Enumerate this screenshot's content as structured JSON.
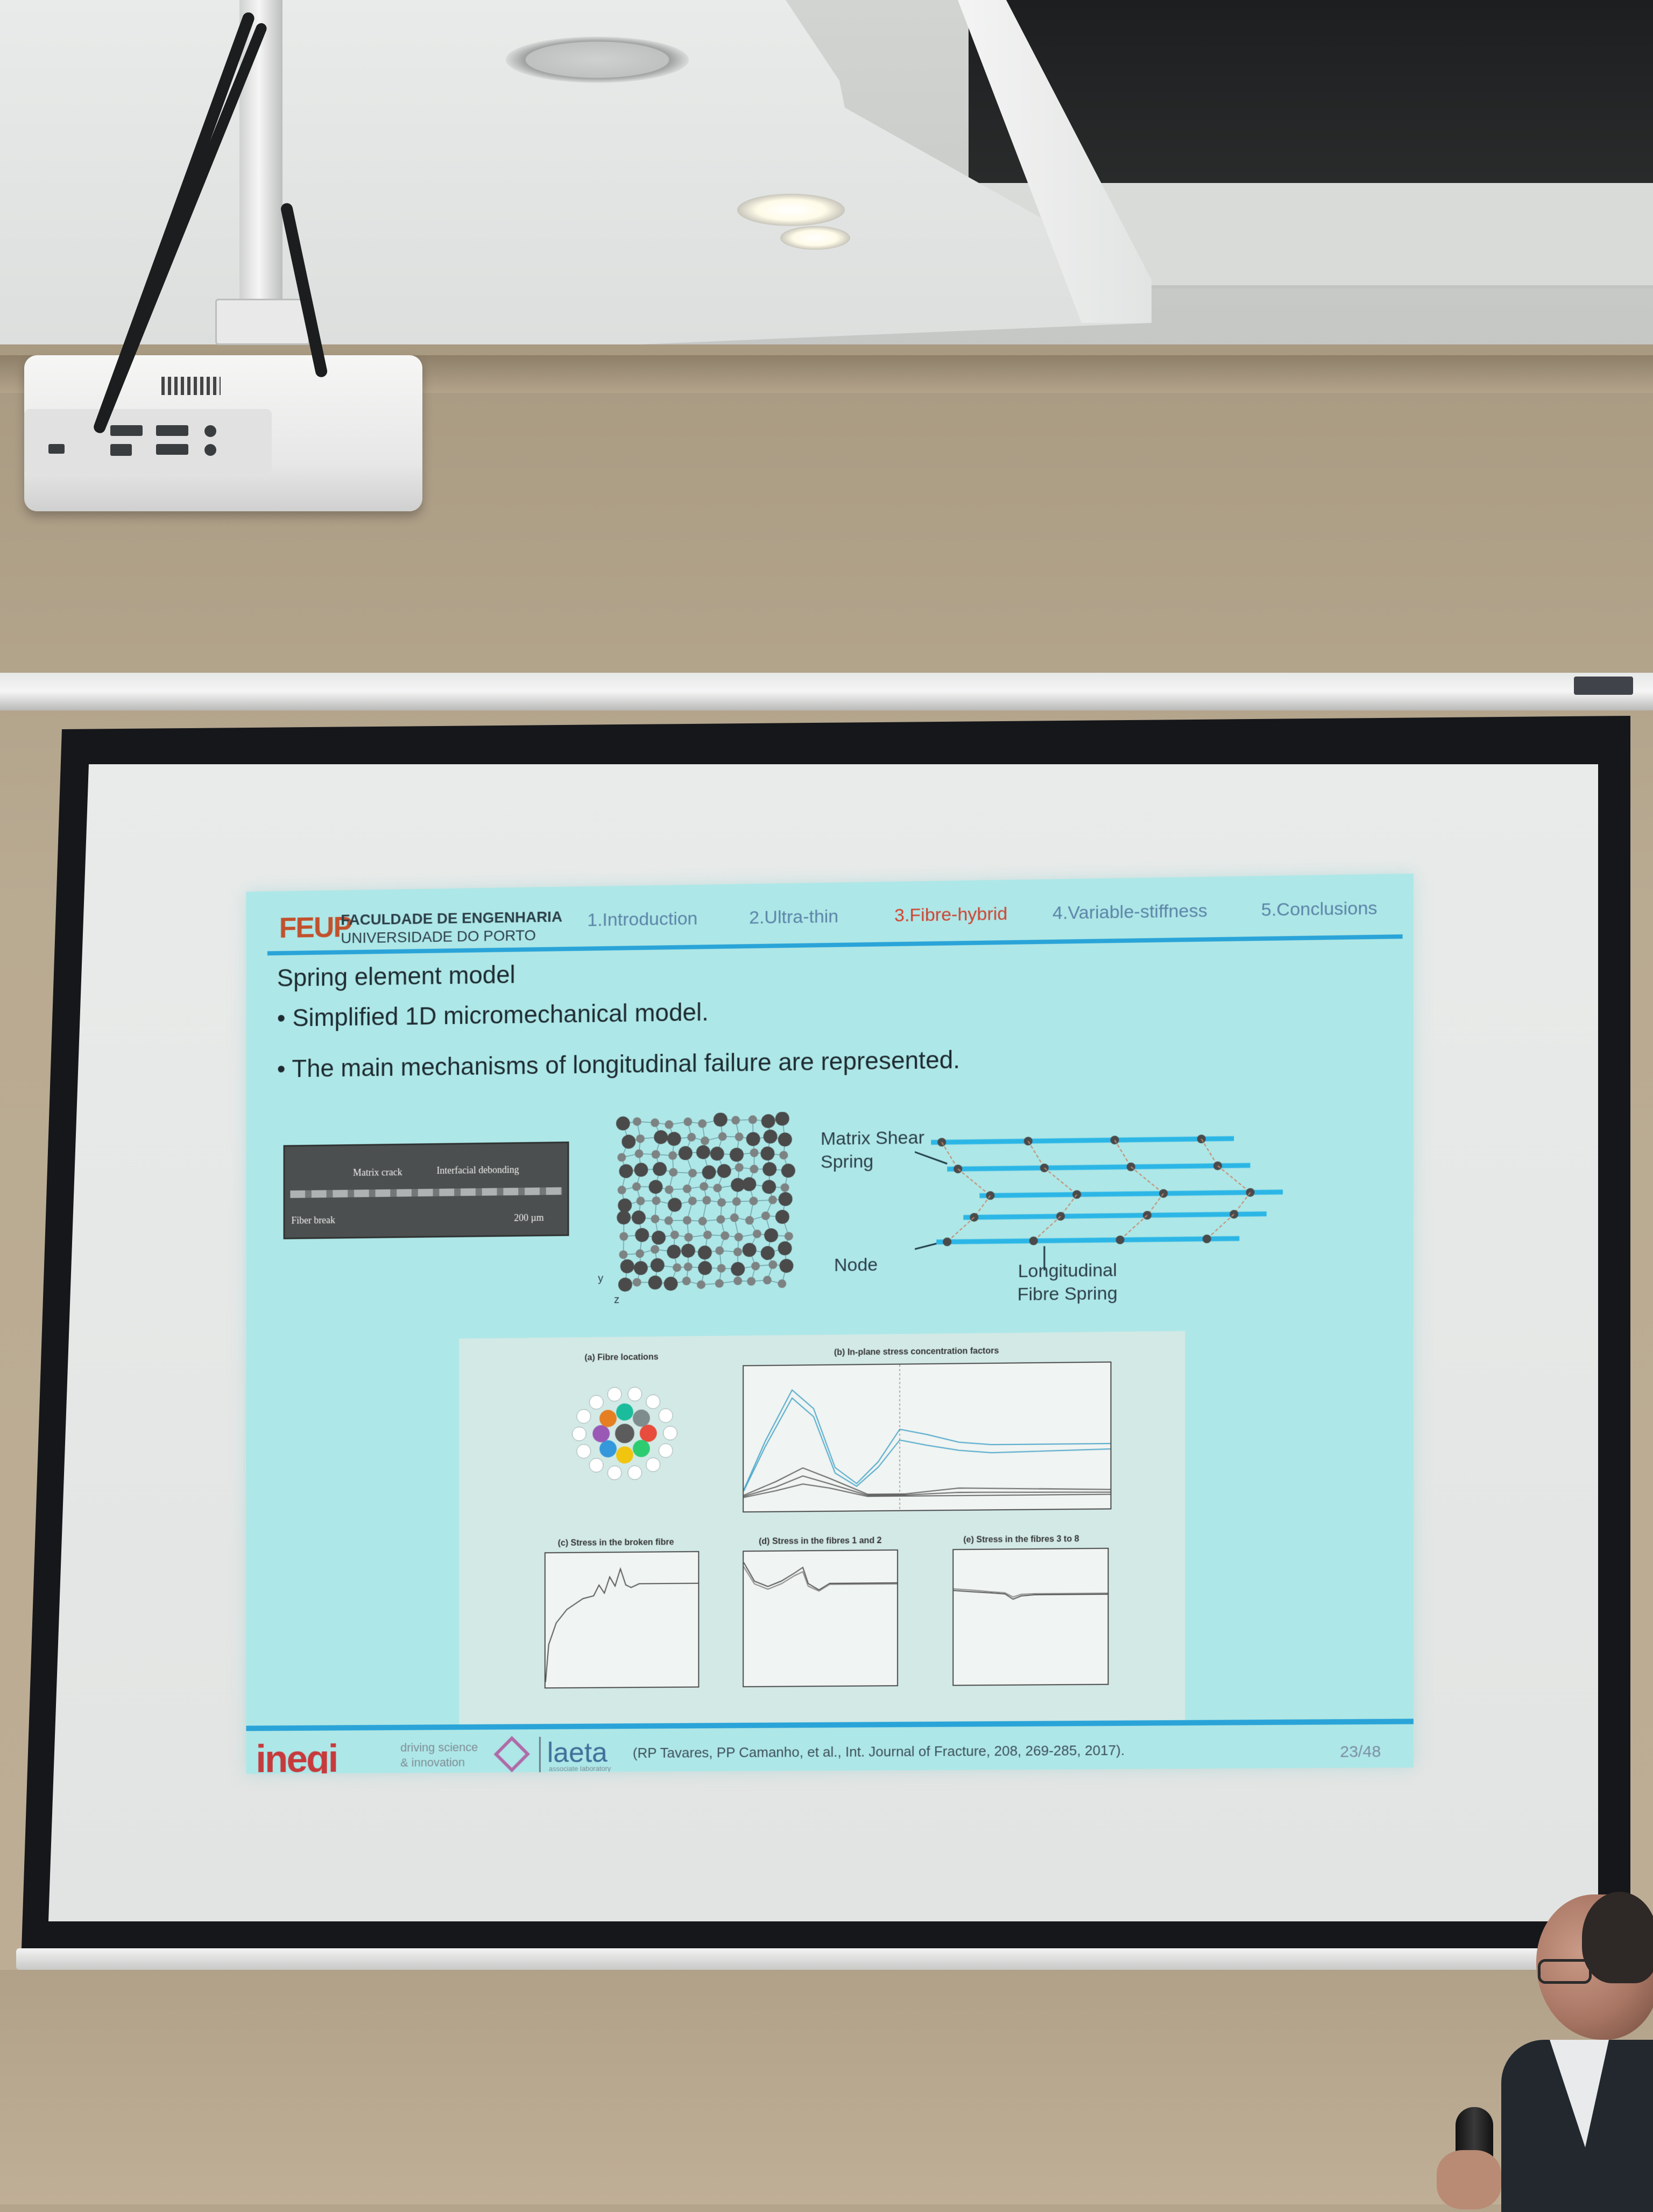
{
  "slide": {
    "header": {
      "logo": "FEUP",
      "faculty_line1": "FACULDADE DE ENGENHARIA",
      "faculty_line2": "UNIVERSIDADE DO PORTO",
      "nav": [
        {
          "label": "1.Introduction",
          "active": false
        },
        {
          "label": "2.Ultra-thin",
          "active": false
        },
        {
          "label": "3.Fibre-hybrid",
          "active": true
        },
        {
          "label": "4.Variable-stiffness",
          "active": false
        },
        {
          "label": "5.Conclusions",
          "active": false
        }
      ]
    },
    "title": "Spring element model",
    "bullets": [
      "• Simplified 1D micromechanical model.",
      "• The main mechanisms of longitudinal failure are represented."
    ],
    "micrograph": {
      "matrix_crack": "Matrix crack",
      "interfacial_debonding": "Interfacial debonding",
      "fiber_break": "Fiber break",
      "scale": "200 µm"
    },
    "fibre_pack_axes": {
      "y": "y",
      "z": "z"
    },
    "spring_model": {
      "matrix_shear_line1": "Matrix Shear",
      "matrix_shear_line2": "Spring",
      "node": "Node",
      "longitudinal_line1": "Longitudinal",
      "longitudinal_line2": "Fibre Spring"
    },
    "figures": {
      "a": "(a) Fibre locations",
      "b": "(b) In-plane stress concentration factors",
      "c": "(c) Stress in the broken fibre",
      "d": "(d) Stress in the fibres 1 and 2",
      "e": "(e) Stress in the fibres 3 to 8"
    },
    "footer": {
      "ineqi": "ineqi",
      "ineqi_tag1": "driving science",
      "ineqi_tag2": "& innovation",
      "laeta": "laeta",
      "laeta_sub": "associate laboratory",
      "reference": "(RP Tavares, PP Camanho, et al., Int. Journal of Fracture, 208, 269-285, 2017).",
      "page": "23/48"
    },
    "colors": {
      "background": "#aee7e7",
      "accent_line": "#2aa4d8",
      "active_nav": "#d0412f",
      "nav": "#5a84a8",
      "fibre_spring": "#2bb6e6"
    }
  }
}
